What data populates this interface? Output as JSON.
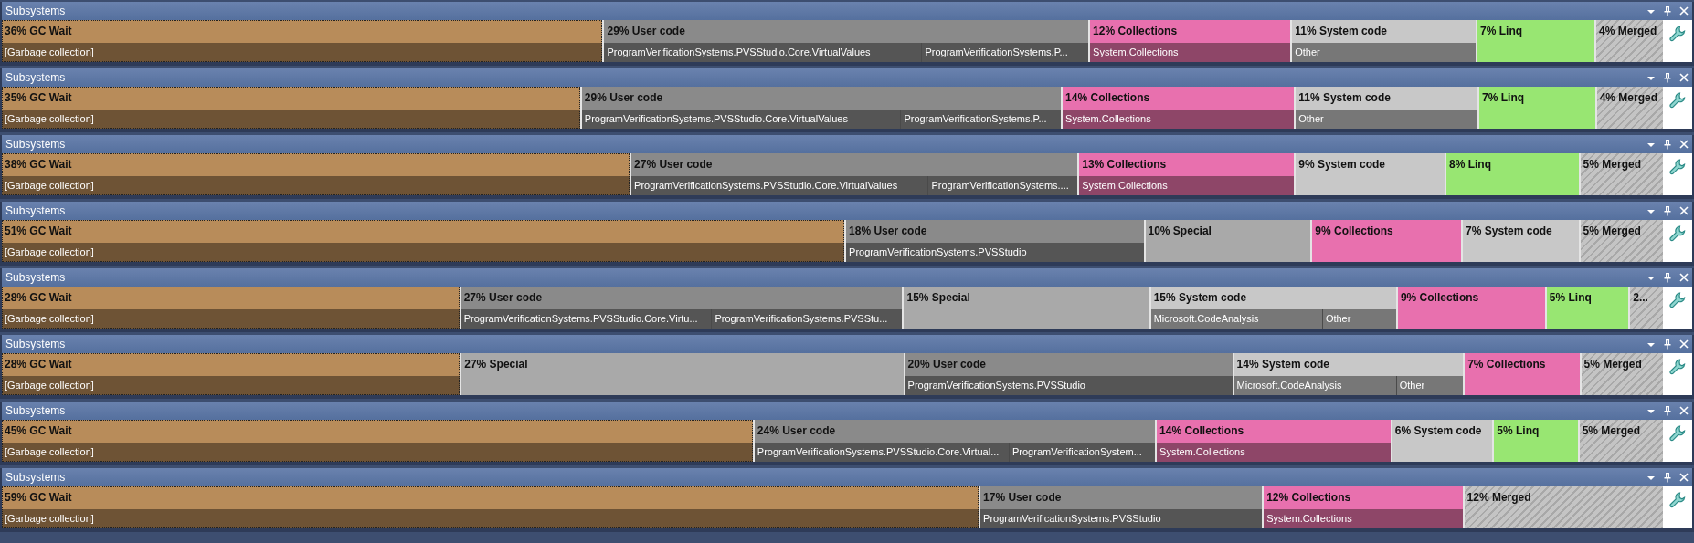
{
  "panels": [
    {
      "title": "Subsystems",
      "segments": [
        {
          "kind": "gc",
          "label": "36% GC Wait",
          "selected": true,
          "items": [
            {
              "label": "[Garbage collection]",
              "level": 1
            }
          ]
        },
        {
          "kind": "user",
          "label": "29% User code",
          "selected": false,
          "items": [
            {
              "label": "ProgramVerificationSystems.PVSStudio.Core.VirtualValues",
              "level": 0.66
            },
            {
              "label": "ProgramVerificationSystems.P...",
              "level": 0.34
            }
          ]
        },
        {
          "kind": "collections",
          "label": "12% Collections",
          "selected": false,
          "items": [
            {
              "label": "System.Collections",
              "level": 1
            }
          ]
        },
        {
          "kind": "system",
          "label": "11% System code",
          "selected": false,
          "items": [
            {
              "label": "Other",
              "level": 1
            }
          ]
        },
        {
          "kind": "linq",
          "label": "7% Linq",
          "selected": false
        },
        {
          "kind": "merged",
          "label": "4% Merged",
          "selected": false
        }
      ]
    },
    {
      "title": "Subsystems",
      "segments": [
        {
          "kind": "gc",
          "label": "35% GC Wait",
          "selected": true,
          "items": [
            {
              "label": "[Garbage collection]",
              "level": 1
            }
          ]
        },
        {
          "kind": "user",
          "label": "29% User code",
          "selected": false,
          "items": [
            {
              "label": "ProgramVerificationSystems.PVSStudio.Core.VirtualValues",
              "level": 0.67
            },
            {
              "label": "ProgramVerificationSystems.P...",
              "level": 0.33
            }
          ]
        },
        {
          "kind": "collections",
          "label": "14% Collections",
          "selected": false,
          "items": [
            {
              "label": "System.Collections",
              "level": 1
            }
          ]
        },
        {
          "kind": "system",
          "label": "11% System code",
          "selected": false,
          "items": [
            {
              "label": "Other",
              "level": 1
            }
          ]
        },
        {
          "kind": "linq",
          "label": "7% Linq",
          "selected": false
        },
        {
          "kind": "merged",
          "label": "4% Merged",
          "selected": false
        }
      ]
    },
    {
      "title": "Subsystems",
      "segments": [
        {
          "kind": "gc",
          "label": "38% GC Wait",
          "selected": true,
          "items": [
            {
              "label": "[Garbage collection]",
              "level": 1
            }
          ]
        },
        {
          "kind": "user",
          "label": "27% User code",
          "selected": false,
          "items": [
            {
              "label": "ProgramVerificationSystems.PVSStudio.Core.VirtualValues",
              "level": 0.67
            },
            {
              "label": "ProgramVerificationSystems....",
              "level": 0.33
            }
          ]
        },
        {
          "kind": "collections",
          "label": "13% Collections",
          "selected": false,
          "items": [
            {
              "label": "System.Collections",
              "level": 1
            }
          ]
        },
        {
          "kind": "system",
          "label": "9% System code",
          "selected": false
        },
        {
          "kind": "linq",
          "label": "8% Linq",
          "selected": false
        },
        {
          "kind": "merged",
          "label": "5% Merged",
          "selected": false
        }
      ]
    },
    {
      "title": "Subsystems",
      "segments": [
        {
          "kind": "gc",
          "label": "51% GC Wait",
          "selected": true,
          "items": [
            {
              "label": "[Garbage collection]",
              "level": 1
            }
          ]
        },
        {
          "kind": "user",
          "label": "18% User code",
          "selected": false,
          "items": [
            {
              "label": "ProgramVerificationSystems.PVSStudio",
              "level": 1
            }
          ]
        },
        {
          "kind": "special",
          "label": "10% Special",
          "selected": false
        },
        {
          "kind": "collections",
          "label": "9% Collections",
          "selected": false
        },
        {
          "kind": "system",
          "label": "7% System code",
          "selected": false
        },
        {
          "kind": "merged",
          "label": "5% Merged",
          "selected": false
        }
      ]
    },
    {
      "title": "Subsystems",
      "segments": [
        {
          "kind": "gc",
          "label": "28% GC Wait",
          "selected": true,
          "items": [
            {
              "label": "[Garbage collection]",
              "level": 1
            }
          ]
        },
        {
          "kind": "user",
          "label": "27% User code",
          "selected": false,
          "items": [
            {
              "label": "ProgramVerificationSystems.PVSStudio.Core.Virtu...",
              "level": 0.57
            },
            {
              "label": "ProgramVerificationSystems.PVSStu...",
              "level": 0.43
            }
          ]
        },
        {
          "kind": "special",
          "label": "15% Special",
          "selected": false
        },
        {
          "kind": "system",
          "label": "15% System code",
          "selected": false,
          "items": [
            {
              "label": "Microsoft.CodeAnalysis",
              "level": 0.71
            },
            {
              "label": "Other",
              "level": 0.29
            }
          ]
        },
        {
          "kind": "collections",
          "label": "9% Collections",
          "selected": false
        },
        {
          "kind": "linq",
          "label": "5% Linq",
          "selected": false
        },
        {
          "kind": "merged",
          "label": "2...",
          "selected": false
        }
      ]
    },
    {
      "title": "Subsystems",
      "segments": [
        {
          "kind": "gc",
          "label": "28% GC Wait",
          "selected": true,
          "items": [
            {
              "label": "[Garbage collection]",
              "level": 1
            }
          ]
        },
        {
          "kind": "special",
          "label": "27% Special",
          "selected": false
        },
        {
          "kind": "user",
          "label": "20% User code",
          "selected": false,
          "items": [
            {
              "label": "ProgramVerificationSystems.PVSStudio",
              "level": 1
            }
          ]
        },
        {
          "kind": "system",
          "label": "14% System code",
          "selected": false,
          "items": [
            {
              "label": "Microsoft.CodeAnalysis",
              "level": 0.72
            },
            {
              "label": "Other",
              "level": 0.28
            }
          ]
        },
        {
          "kind": "collections",
          "label": "7% Collections",
          "selected": false
        },
        {
          "kind": "merged",
          "label": "5% Merged",
          "selected": false
        }
      ]
    },
    {
      "title": "Subsystems",
      "segments": [
        {
          "kind": "gc",
          "label": "45% GC Wait",
          "selected": true,
          "items": [
            {
              "label": "[Garbage collection]",
              "level": 1
            }
          ]
        },
        {
          "kind": "user",
          "label": "24% User code",
          "selected": false,
          "items": [
            {
              "label": "ProgramVerificationSystems.PVSStudio.Core.Virtual...",
              "level": 0.64
            },
            {
              "label": "ProgramVerificationSystem...",
              "level": 0.36
            }
          ]
        },
        {
          "kind": "collections",
          "label": "14% Collections",
          "selected": false,
          "items": [
            {
              "label": "System.Collections",
              "level": 1
            }
          ]
        },
        {
          "kind": "system",
          "label": "6% System code",
          "selected": false
        },
        {
          "kind": "linq",
          "label": "5% Linq",
          "selected": false
        },
        {
          "kind": "merged",
          "label": "5% Merged",
          "selected": false
        }
      ]
    },
    {
      "title": "Subsystems",
      "segments": [
        {
          "kind": "gc",
          "label": "59% GC Wait",
          "selected": true,
          "items": [
            {
              "label": "[Garbage collection]",
              "level": 1
            }
          ]
        },
        {
          "kind": "user",
          "label": "17% User code",
          "selected": false,
          "items": [
            {
              "label": "ProgramVerificationSystems.PVSStudio",
              "level": 1
            }
          ]
        },
        {
          "kind": "collections",
          "label": "12% Collections",
          "selected": false,
          "items": [
            {
              "label": "System.Collections",
              "level": 1
            }
          ]
        },
        {
          "kind": "merged",
          "label": "12% Merged",
          "selected": false
        }
      ]
    }
  ]
}
